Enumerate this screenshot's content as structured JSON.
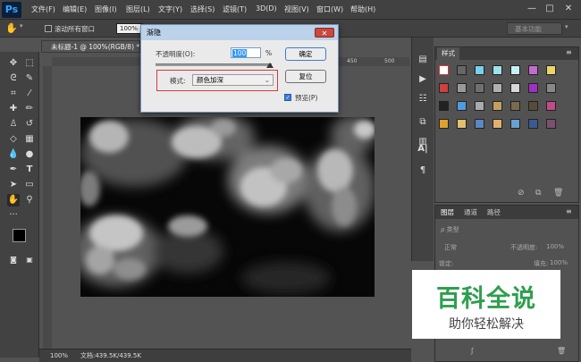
{
  "app": {
    "logo": "Ps"
  },
  "menu": [
    "文件(F)",
    "编辑(E)",
    "图像(I)",
    "图层(L)",
    "文字(Y)",
    "选择(S)",
    "滤镜(T)",
    "3D(D)",
    "视图(V)",
    "窗口(W)",
    "帮助(H)"
  ],
  "window_controls": {
    "minimize": "—",
    "maximize": "□",
    "close": "✕"
  },
  "options_bar": {
    "scroll_all_label": "滚动所有窗口",
    "zoom_value": "100%",
    "workspace": "基本功能"
  },
  "document": {
    "tab_title": "未标题-1 @ 100%(RGB/8) *"
  },
  "ruler": {
    "marks": [
      "450",
      "500"
    ]
  },
  "status": {
    "zoom": "100%",
    "doc_size": "文档:439.5K/439.5K"
  },
  "dialog": {
    "title": "渐隐",
    "close": "✕",
    "opacity_label": "不透明度(O):",
    "opacity_value": "100",
    "opacity_unit": "%",
    "mode_label": "模式:",
    "mode_value": "颜色加深",
    "ok_label": "确定",
    "reset_label": "复位",
    "preview_label": "预览(P)",
    "preview_checked": true
  },
  "styles_panel": {
    "tab": "样式"
  },
  "layers_panel": {
    "tabs": [
      "图层",
      "通道",
      "路径"
    ],
    "kind_label": "ρ 类型",
    "blend_mode": "正常",
    "opacity_label": "不透明度:",
    "opacity_value": "100%",
    "lock_label": "锁定:",
    "fill_label": "填充:",
    "fill_value": "100%"
  },
  "watermark": {
    "title": "百科全说",
    "subtitle": "助你轻松解决"
  },
  "colors": {
    "ps_blue": "#31a8ff",
    "highlight_red": "#d63a3a",
    "watermark_green": "#2e9f4d"
  }
}
